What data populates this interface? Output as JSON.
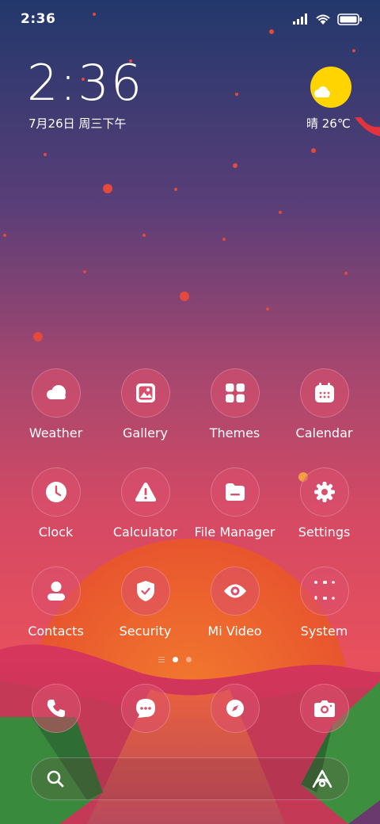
{
  "status_bar": {
    "time": "2:36",
    "icons": [
      "signal-icon",
      "wifi-icon",
      "battery-icon"
    ]
  },
  "clock_widget": {
    "time": "2:36",
    "date": "7月26日 周三下午"
  },
  "weather_widget": {
    "text": "晴 26℃",
    "icon": "sunny-cloud-icon",
    "sun_color": "#FFD400"
  },
  "apps": [
    {
      "label": "Weather",
      "icon": "weather-cloud-icon"
    },
    {
      "label": "Gallery",
      "icon": "gallery-image-icon"
    },
    {
      "label": "Themes",
      "icon": "themes-grid-icon"
    },
    {
      "label": "Calendar",
      "icon": "calendar-icon"
    },
    {
      "label": "Clock",
      "icon": "clock-icon"
    },
    {
      "label": "Calculator",
      "icon": "calculator-warning-icon"
    },
    {
      "label": "File Manager",
      "icon": "folder-icon"
    },
    {
      "label": "Settings",
      "icon": "gear-icon"
    },
    {
      "label": "Contacts",
      "icon": "person-icon"
    },
    {
      "label": "Security",
      "icon": "shield-check-icon"
    },
    {
      "label": "Mi Video",
      "icon": "eye-icon"
    },
    {
      "label": "System",
      "icon": "folder-mini-icons"
    }
  ],
  "page_indicator": {
    "pages": 2,
    "active": 1
  },
  "dock": [
    {
      "icon": "phone-icon"
    },
    {
      "icon": "messages-icon"
    },
    {
      "icon": "browser-compass-icon"
    },
    {
      "icon": "camera-icon"
    }
  ],
  "search_bar": {
    "left_icon": "search-icon",
    "right_icon": "assistant-a-icon"
  },
  "colors": {
    "sky_top": "#243A6E",
    "sky_mid": "#C2456E",
    "sky_low": "#E8505C",
    "sun": "#F06A2A",
    "icon_bg": "#DC506E"
  }
}
